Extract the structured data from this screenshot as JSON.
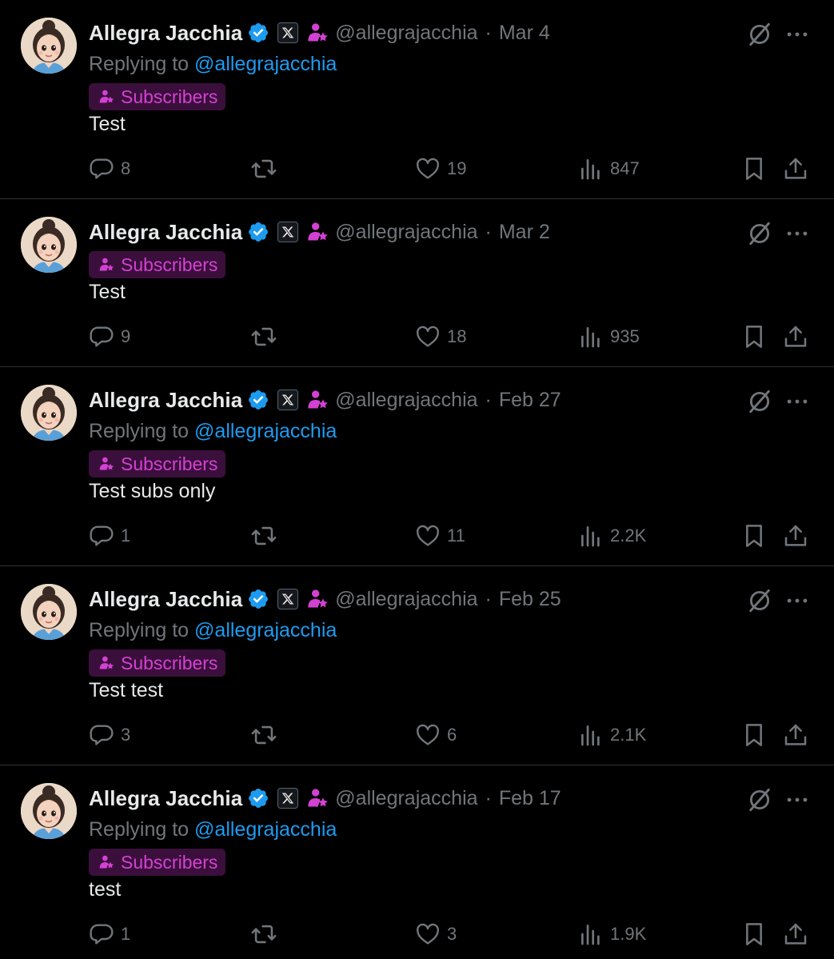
{
  "colors": {
    "background": "#000000",
    "text_primary": "#e7e9ea",
    "text_secondary": "#71767b",
    "link": "#1d9bf0",
    "subscriber_badge_bg": "#3b0f3b",
    "subscriber_accent": "#d341d3",
    "verified": "#1d9bf0",
    "divider": "#2f3336"
  },
  "icons": {
    "verified": "verified-badge-icon",
    "x_affiliate": "x-logo-icon",
    "subscriber": "subscriber-star-icon",
    "grok": "grok-icon",
    "more": "more-dots-icon",
    "reply": "reply-icon",
    "repost": "repost-icon",
    "like": "heart-icon",
    "views": "views-chart-icon",
    "bookmark": "bookmark-icon",
    "share": "share-icon"
  },
  "posts": [
    {
      "name": "Allegra Jacchia",
      "handle": "@allegrajacchia",
      "separator": "·",
      "date": "Mar 4",
      "replying_prefix": "Replying to ",
      "replying_to": "@allegrajacchia",
      "badge": "Subscribers",
      "text": "Test",
      "replies": "8",
      "reposts": "",
      "likes": "19",
      "views": "847"
    },
    {
      "name": "Allegra Jacchia",
      "handle": "@allegrajacchia",
      "separator": "·",
      "date": "Mar 2",
      "replying_prefix": "",
      "replying_to": "",
      "badge": "Subscribers",
      "text": "Test",
      "replies": "9",
      "reposts": "",
      "likes": "18",
      "views": "935"
    },
    {
      "name": "Allegra Jacchia",
      "handle": "@allegrajacchia",
      "separator": "·",
      "date": "Feb 27",
      "replying_prefix": "Replying to ",
      "replying_to": "@allegrajacchia",
      "badge": "Subscribers",
      "text": "Test subs only",
      "replies": "1",
      "reposts": "",
      "likes": "11",
      "views": "2.2K"
    },
    {
      "name": "Allegra Jacchia",
      "handle": "@allegrajacchia",
      "separator": "·",
      "date": "Feb 25",
      "replying_prefix": "Replying to ",
      "replying_to": "@allegrajacchia",
      "badge": "Subscribers",
      "text": "Test test",
      "replies": "3",
      "reposts": "",
      "likes": "6",
      "views": "2.1K"
    },
    {
      "name": "Allegra Jacchia",
      "handle": "@allegrajacchia",
      "separator": "·",
      "date": "Feb 17",
      "replying_prefix": "Replying to ",
      "replying_to": "@allegrajacchia",
      "badge": "Subscribers",
      "text": "test",
      "replies": "1",
      "reposts": "",
      "likes": "3",
      "views": "1.9K"
    }
  ]
}
